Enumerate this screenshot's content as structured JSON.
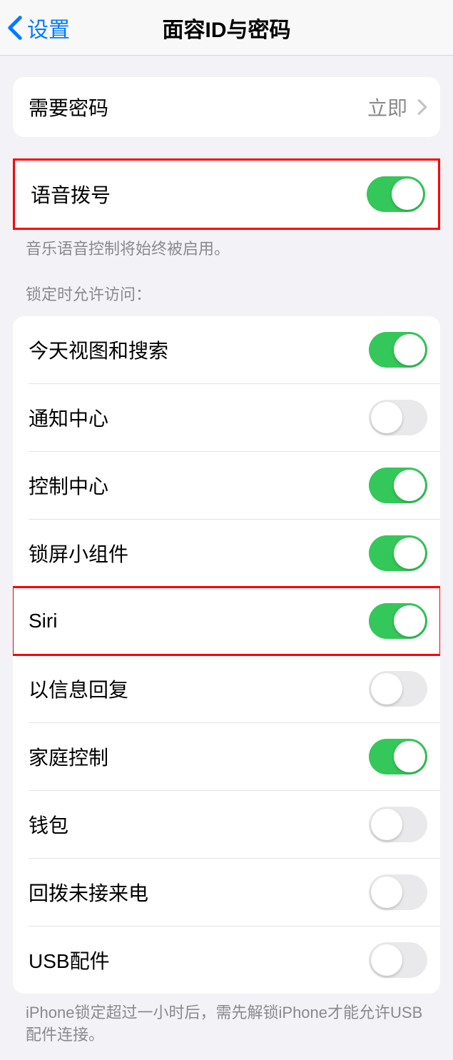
{
  "nav": {
    "back_label": "设置",
    "title": "面容ID与密码"
  },
  "passcode_group": {
    "require_label": "需要密码",
    "require_value": "立即"
  },
  "voice_dial": {
    "label": "语音拨号",
    "enabled": true,
    "footer": "音乐语音控制将始终被启用。"
  },
  "lock_access": {
    "header": "锁定时允许访问：",
    "items": [
      {
        "label": "今天视图和搜索",
        "enabled": true
      },
      {
        "label": "通知中心",
        "enabled": false
      },
      {
        "label": "控制中心",
        "enabled": true
      },
      {
        "label": "锁屏小组件",
        "enabled": true
      },
      {
        "label": "Siri",
        "enabled": true
      },
      {
        "label": "以信息回复",
        "enabled": false
      },
      {
        "label": "家庭控制",
        "enabled": true
      },
      {
        "label": "钱包",
        "enabled": false
      },
      {
        "label": "回拨未接来电",
        "enabled": false
      },
      {
        "label": "USB配件",
        "enabled": false
      }
    ],
    "footer": "iPhone锁定超过一小时后，需先解锁iPhone才能允许USB配件连接。"
  }
}
